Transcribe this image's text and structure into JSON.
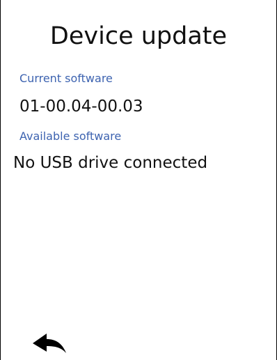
{
  "header": {
    "title": "Device update"
  },
  "current_software": {
    "label": "Current software",
    "value": "01-00.04-00.03"
  },
  "available_software": {
    "label": "Available software",
    "value": "No USB drive connected"
  },
  "navigation": {
    "back_icon": "back-arrow-icon"
  },
  "colors": {
    "label": "#3d63b0",
    "text": "#111111",
    "background": "#ffffff"
  }
}
